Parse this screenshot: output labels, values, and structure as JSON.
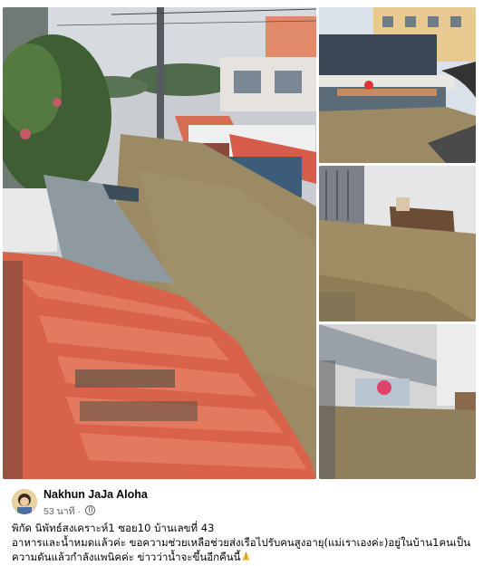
{
  "post": {
    "author": {
      "name": "Nakhun JaJa Aloha",
      "avatar_icon": "profile-photo",
      "timestamp": "53 นาที",
      "separator": "·",
      "privacy_icon": "globe-icon"
    },
    "text_lines": [
      "พิกัด นิพัทธ์สงเคราะห์1 ซอย10 บ้านเลขที่ 43",
      "อาหารและน้ำหมดแล้วค่ะ ขอความช่วยเหลือช่วยส่งเรือไปรับคนสูงอายุ(แม่เราเองค่ะ)อยู่ในบ้าน1คนเป็น",
      "ความดันแล้วกำลังแพนิคค่ะ ข่าวว่าน้ำจะขึ้นอีกคืนนี้"
    ],
    "emoji_icon": "folded-hands-icon",
    "photos": [
      {
        "name": "photo-main",
        "description_icon": "flooded-street-rooftop-photo"
      },
      {
        "name": "photo-2",
        "description_icon": "flooded-shophouses-photo"
      },
      {
        "name": "photo-3",
        "description_icon": "flooded-room-photo"
      },
      {
        "name": "photo-4",
        "description_icon": "flooded-interior-photo"
      }
    ]
  },
  "colors": {
    "floodwater": "#9b8a63",
    "roof_tile": "#d9634a",
    "text_primary": "#050505",
    "text_secondary": "#65676b"
  }
}
